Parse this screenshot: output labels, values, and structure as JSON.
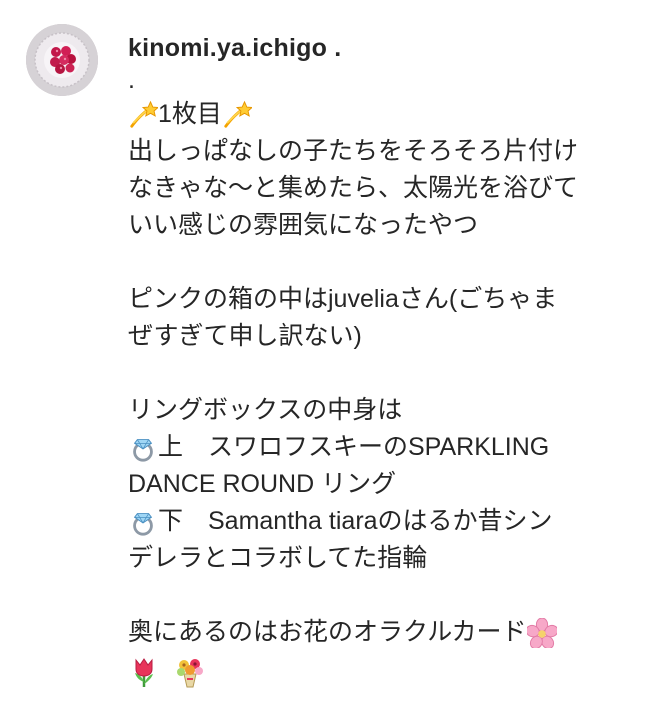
{
  "post": {
    "username": "kinomi.ya.ichigo .",
    "caption": {
      "dot": ".",
      "line1_text": "1枚目",
      "line2": "出しっぱなしの子たちをそろそろ片付け",
      "line3": "なきゃな〜と集めたら、太陽光を浴びて",
      "line4": "いい感じの雰囲気になったやつ",
      "line6": "ピンクの箱の中はjuveliaさん(ごちゃま",
      "line7": "ぜすぎて申し訳ない)",
      "line9": "リングボックスの中身は",
      "line10_text": "上　スワロフスキーのSPARKLING",
      "line11": "DANCE ROUND リング",
      "line12_text": "下　Samantha tiaraのはるか昔シン",
      "line13": "デレラとコラボしてた指輪",
      "line15_text": "奥にあるのはお花のオラクルカード"
    },
    "icons": {
      "avatar": "avatar-raspberries-plate",
      "dizzy": "dizzy-icon",
      "ring": "ring-icon",
      "cherry_blossom": "cherry-blossom-icon",
      "tulip": "tulip-icon",
      "bouquet": "bouquet-icon"
    }
  }
}
